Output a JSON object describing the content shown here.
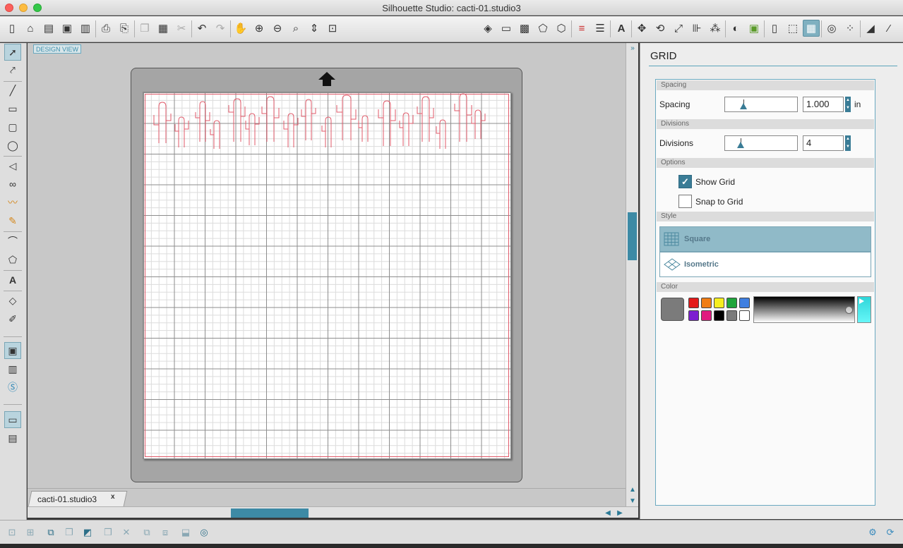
{
  "window": {
    "title": "Silhouette Studio: cacti-01.studio3"
  },
  "canvas": {
    "view_label": "DESIGN VIEW"
  },
  "document_tab": {
    "label": "cacti-01.studio3",
    "close_label": "x"
  },
  "panel": {
    "title": "GRID",
    "sections": {
      "spacing": "Spacing",
      "divisions": "Divisions",
      "options": "Options",
      "style": "Style",
      "color": "Color"
    },
    "spacing": {
      "label": "Spacing",
      "value": "1.000",
      "unit": "in",
      "slider_level": 0.25
    },
    "divisions": {
      "label": "Divisions",
      "value": "4",
      "slider_level": 0.22
    },
    "options": {
      "show_grid": {
        "label": "Show Grid",
        "checked": true
      },
      "snap_to_grid": {
        "label": "Snap to Grid",
        "checked": false
      }
    },
    "styles": [
      {
        "label": "Square",
        "selected": true
      },
      {
        "label": "Isometric",
        "selected": false
      }
    ],
    "color": {
      "current": "#7b7b7b",
      "swatches": [
        "#e41b1b",
        "#f07d14",
        "#f6ee1f",
        "#1fa53a",
        "#3f7fe0",
        "#7d1fd1",
        "#e01a7f",
        "#000000",
        "#7b7b7b",
        "#ffffff"
      ]
    }
  },
  "colors": {
    "accent": "#3a7c96",
    "cut_line": "#e05a6a"
  }
}
